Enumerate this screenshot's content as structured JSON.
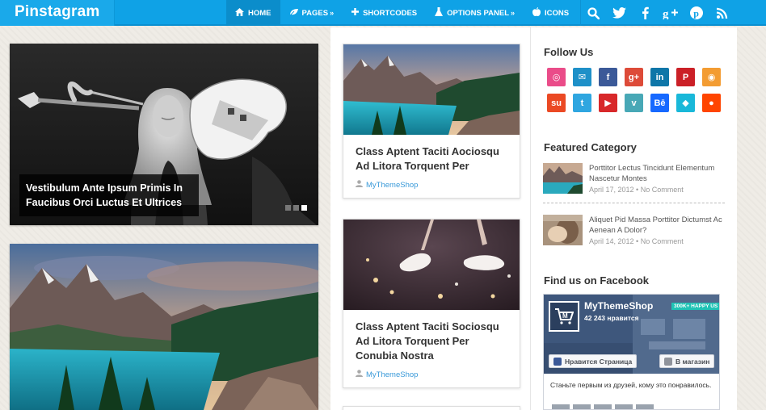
{
  "header": {
    "logo": "Pinstagram",
    "nav": [
      {
        "label": "Home",
        "icon": "home-icon",
        "active": true
      },
      {
        "label": "Pages",
        "icon": "leaf-icon",
        "caret": "»"
      },
      {
        "label": "Shortcodes",
        "icon": "plus-icon"
      },
      {
        "label": "Options Panel",
        "icon": "flask-icon",
        "caret": "»"
      },
      {
        "label": "Icons",
        "icon": "apple-icon"
      }
    ],
    "social": [
      "search-icon",
      "twitter-icon",
      "facebook-icon",
      "google-plus-icon",
      "pinterest-icon",
      "rss-icon"
    ],
    "colors": {
      "bar": "#0fa2e6",
      "active": "#0b8dcb"
    }
  },
  "slider": {
    "caption": "Vestibulum Ante Ipsum Primis In Faucibus Orci Luctus Et Ultrices",
    "dots": 3,
    "active_dot": 3
  },
  "cards": [
    {
      "title": "Class Aptent Taciti Aociosqu Ad Litora Torquent Per",
      "author": "MyThemeShop",
      "image": "mountain-lake-image"
    },
    {
      "title": "Class Aptent Taciti Sociosqu Ad Litora Torquent Per Conubia Nostra",
      "author": "MyThemeShop",
      "image": "white-shoes-image"
    }
  ],
  "sidebar": {
    "follow_title": "Follow Us",
    "follow_icons": [
      {
        "name": "dribbble-icon",
        "glyph": "◎",
        "color": "#ea4c89"
      },
      {
        "name": "email-icon",
        "glyph": "✉",
        "color": "#1e90c8"
      },
      {
        "name": "facebook-icon",
        "glyph": "f",
        "color": "#3b5998"
      },
      {
        "name": "google-plus-icon",
        "glyph": "g+",
        "color": "#dd4b39"
      },
      {
        "name": "linkedin-icon",
        "glyph": "in",
        "color": "#0e76a8"
      },
      {
        "name": "pinterest-icon",
        "glyph": "P",
        "color": "#cb2027"
      },
      {
        "name": "rss-icon",
        "glyph": "◉",
        "color": "#f39c32"
      },
      {
        "name": "stumbleupon-icon",
        "glyph": "su",
        "color": "#eb4924"
      },
      {
        "name": "twitter-icon",
        "glyph": "t",
        "color": "#2fa6e0"
      },
      {
        "name": "youtube-icon",
        "glyph": "▶",
        "color": "#d8282a"
      },
      {
        "name": "vimeo-icon",
        "glyph": "v",
        "color": "#48a8b6"
      },
      {
        "name": "behance-icon",
        "glyph": "Bē",
        "color": "#1769ff"
      },
      {
        "name": "delicious-icon",
        "glyph": "◆",
        "color": "#19b8d9"
      },
      {
        "name": "reddit-icon",
        "glyph": "●",
        "color": "#ff4500"
      }
    ],
    "featured_title": "Featured Category",
    "featured": [
      {
        "title": "Porttitor Lectus Tincidunt Elementum Nascetur Montes",
        "date": "April 17, 2012",
        "comments": "No Comment"
      },
      {
        "title": "Aliquet Pid Massa Porttitor Dictumst Ac Aenean A Dolor?",
        "date": "April 14, 2012",
        "comments": "No Comment"
      }
    ],
    "facebook_title": "Find us on Facebook",
    "facebook": {
      "page_name": "MyThemeShop",
      "likes": "42 243 нравится",
      "badge": "300K+ HAPPY US",
      "like_button": "Нравится Страница",
      "shop_button": "В магазин",
      "friends_text": "Станьте первым из друзей, кому это понравилось."
    }
  }
}
